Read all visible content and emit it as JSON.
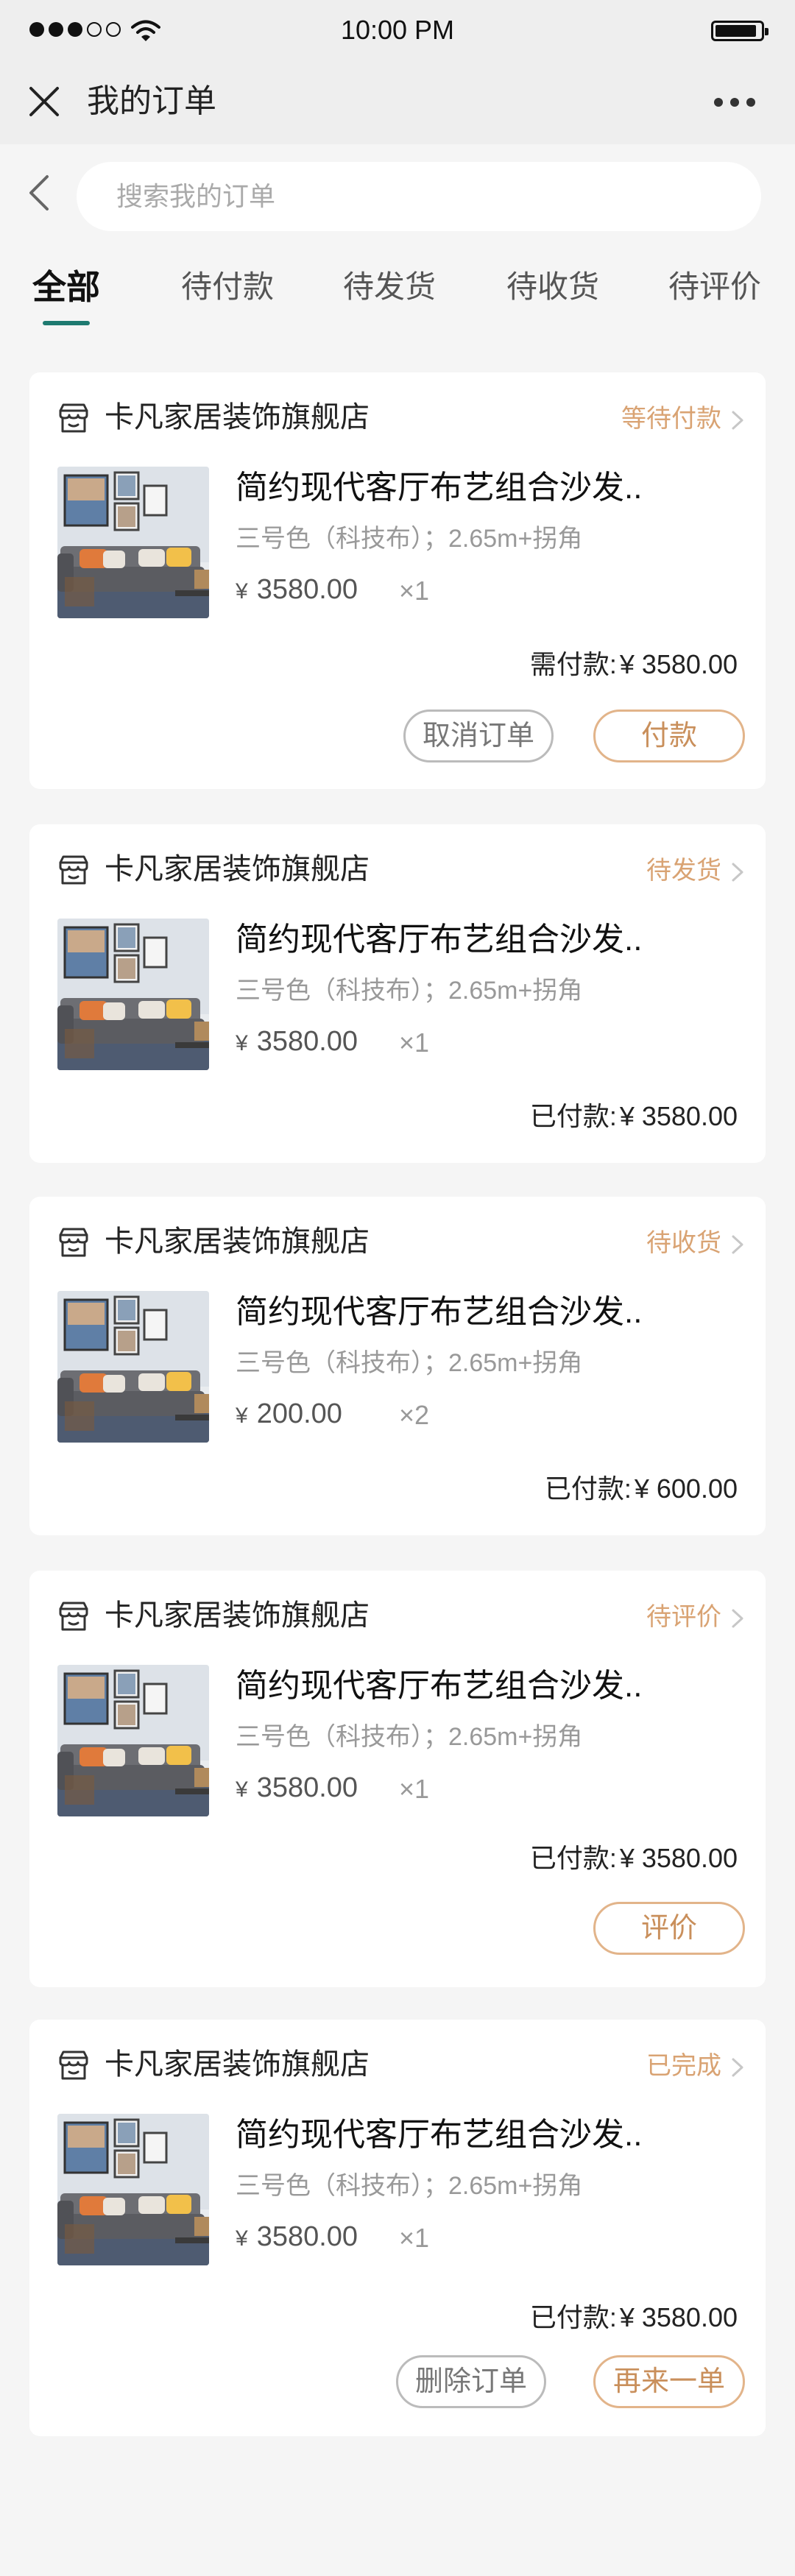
{
  "status_bar": {
    "time": "10:00 PM"
  },
  "nav": {
    "title": "我的订单"
  },
  "search": {
    "placeholder": "搜索我的订单"
  },
  "tabs": [
    {
      "label": "全部",
      "active": true
    },
    {
      "label": "待付款"
    },
    {
      "label": "待发货"
    },
    {
      "label": "待收货"
    },
    {
      "label": "待评价"
    }
  ],
  "colors": {
    "accent": "#1e7a70",
    "status": "#d9a373",
    "button_gold": "#c98f5b"
  },
  "orders": [
    {
      "shop": "卡凡家居装饰旗舰店",
      "status": "等待付款",
      "product": "简约现代客厅布艺组合沙发..",
      "spec": "三号色（科技布）；2.65m+拐角",
      "currency": "¥",
      "price": "3580.00",
      "qty": "×1",
      "total_label": "需付款:",
      "total": "3580.00",
      "buttons": [
        "取消订单",
        "付款"
      ]
    },
    {
      "shop": "卡凡家居装饰旗舰店",
      "status": "待发货",
      "product": "简约现代客厅布艺组合沙发..",
      "spec": "三号色（科技布）；2.65m+拐角",
      "currency": "¥",
      "price": "3580.00",
      "qty": "×1",
      "total_label": "已付款:",
      "total": "3580.00",
      "buttons": []
    },
    {
      "shop": "卡凡家居装饰旗舰店",
      "status": "待收货",
      "product": "简约现代客厅布艺组合沙发..",
      "spec": "三号色（科技布）；2.65m+拐角",
      "currency": "¥",
      "price": "200.00",
      "qty": "×2",
      "total_label": "已付款:",
      "total": "600.00",
      "buttons": []
    },
    {
      "shop": "卡凡家居装饰旗舰店",
      "status": "待评价",
      "product": "简约现代客厅布艺组合沙发..",
      "spec": "三号色（科技布）；2.65m+拐角",
      "currency": "¥",
      "price": "3580.00",
      "qty": "×1",
      "total_label": "已付款:",
      "total": "3580.00",
      "buttons": [
        "评价"
      ]
    },
    {
      "shop": "卡凡家居装饰旗舰店",
      "status": "已完成",
      "product": "简约现代客厅布艺组合沙发..",
      "spec": "三号色（科技布）；2.65m+拐角",
      "currency": "¥",
      "price": "3580.00",
      "qty": "×1",
      "total_label": "已付款:",
      "total": "3580.00",
      "buttons": [
        "删除订单",
        "再来一单"
      ]
    }
  ]
}
